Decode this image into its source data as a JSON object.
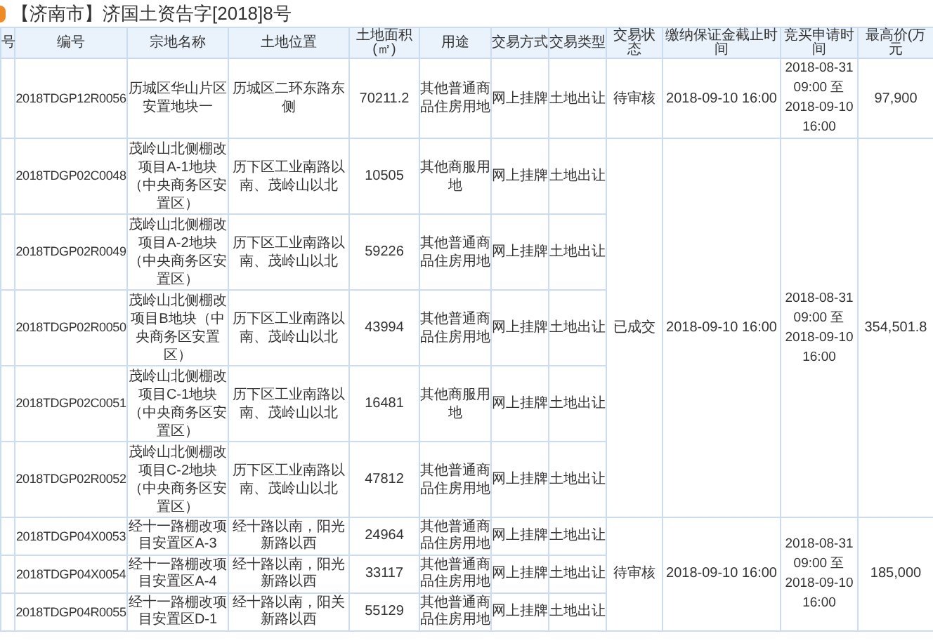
{
  "title": "【济南市】济国土资告字[2018]8号",
  "columns": [
    "号",
    "编号",
    "宗地名称",
    "土地位置",
    "土地面积(㎡)",
    "用途",
    "交易方式",
    "交易类型",
    "交易状态",
    "缴纳保证金截止时间",
    "竞买申请时间",
    "最高价(万元"
  ],
  "groups": [
    {
      "status": "待审核",
      "deadline": "2018-09-10 16:00",
      "apply_time": "2018-08-31 09:00 至 2018-09-10 16:00",
      "max_price": "97,900",
      "parcels": [
        {
          "code": "2018TDGP12R0056",
          "name": "历城区华山片区安置地块一",
          "location": "历城区二环东路东侧",
          "area": "70211.2",
          "use": "其他普通商品住房用地",
          "method": "网上挂牌",
          "type": "土地出让"
        }
      ]
    },
    {
      "status": "已成交",
      "deadline": "2018-09-10 16:00",
      "apply_time": "2018-08-31 09:00 至 2018-09-10 16:00",
      "max_price": "354,501.8",
      "parcels": [
        {
          "code": "2018TDGP02C0048",
          "name": "茂岭山北侧棚改项目A-1地块（中央商务区安置区）",
          "location": "历下区工业南路以南、茂岭山以北",
          "area": "10505",
          "use": "其他商服用地",
          "method": "网上挂牌",
          "type": "土地出让"
        },
        {
          "code": "2018TDGP02R0049",
          "name": "茂岭山北侧棚改项目A-2地块（中央商务区安置区）",
          "location": "历下区工业南路以南、茂岭山以北",
          "area": "59226",
          "use": "其他普通商品住房用地",
          "method": "网上挂牌",
          "type": "土地出让"
        },
        {
          "code": "2018TDGP02R0050",
          "name": "茂岭山北侧棚改项目B地块（中央商务区安置区）",
          "location": "历下区工业南路以南、茂岭山以北",
          "area": "43994",
          "use": "其他普通商品住房用地",
          "method": "网上挂牌",
          "type": "土地出让"
        },
        {
          "code": "2018TDGP02C0051",
          "name": "茂岭山北侧棚改项目C-1地块（中央商务区安置区）",
          "location": "历下区工业南路以南、茂岭山以北",
          "area": "16481",
          "use": "其他商服用地",
          "method": "网上挂牌",
          "type": "土地出让"
        },
        {
          "code": "2018TDGP02R0052",
          "name": "茂岭山北侧棚改项目C-2地块（中央商务区安置区）",
          "location": "历下区工业南路以南、茂岭山以北",
          "area": "47812",
          "use": "其他普通商品住房用地",
          "method": "网上挂牌",
          "type": "土地出让"
        }
      ]
    },
    {
      "status": "待审核",
      "deadline": "2018-09-10 16:00",
      "apply_time": "2018-08-31 09:00 至 2018-09-10 16:00",
      "max_price": "185,000",
      "parcels": [
        {
          "code": "2018TDGP04X0053",
          "name": "经十一路棚改项目安置区A-3",
          "location": "经十路以南，阳光新路以西",
          "area": "24964",
          "use": "其他普通商品住房用地",
          "method": "网上挂牌",
          "type": "土地出让"
        },
        {
          "code": "2018TDGP04X0054",
          "name": "经十一路棚改项目安置区A-4",
          "location": "经十路以南，阳光新路以西",
          "area": "33117",
          "use": "其他普通商品住房用地",
          "method": "网上挂牌",
          "type": "土地出让"
        },
        {
          "code": "2018TDGP04R0055",
          "name": "经十一路棚改项目安置区D-1",
          "location": "经十路以南，阳关新路以西",
          "area": "55129",
          "use": "其他普通商品住房用地",
          "method": "网上挂牌",
          "type": "土地出让"
        }
      ]
    }
  ]
}
